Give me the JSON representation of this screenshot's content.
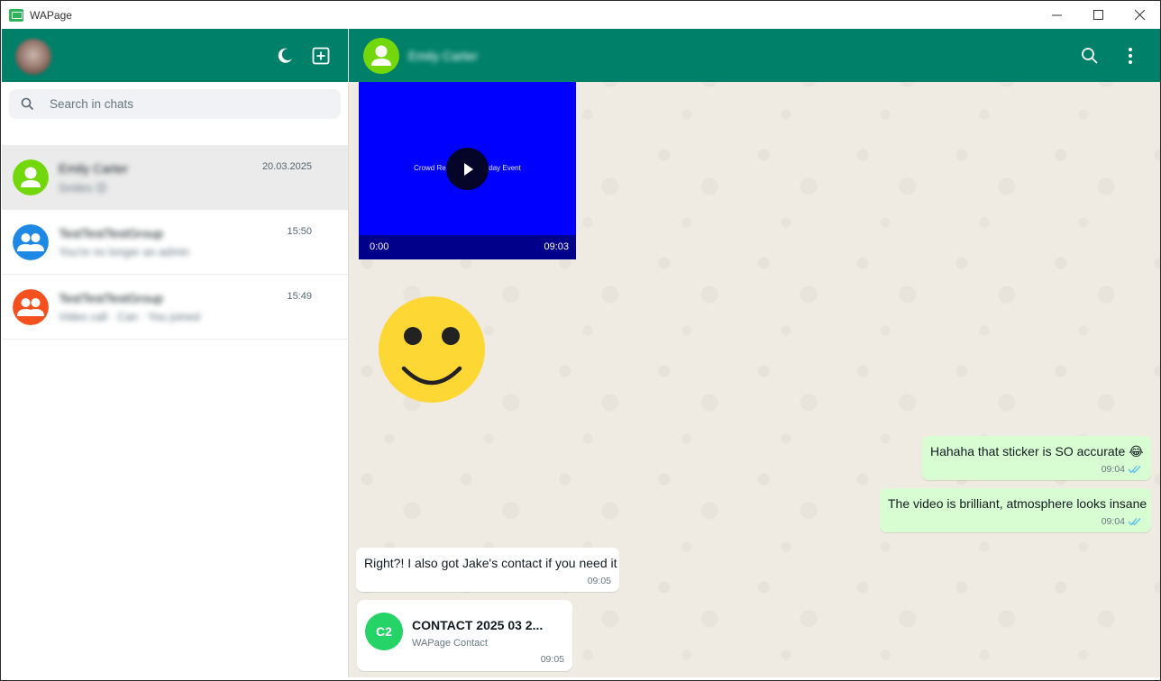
{
  "app": {
    "title": "WAPage"
  },
  "window_controls": {
    "minimize": "—",
    "maximize": "☐",
    "close": "✕"
  },
  "sidebar": {
    "search": {
      "placeholder": "Search in chats",
      "value": ""
    },
    "chats": [
      {
        "name": "Emily Carter",
        "preview": "Smiles 😊",
        "time": "20.03.2025",
        "avatar_color": "#72d70b",
        "avatar_kind": "person",
        "active": true
      },
      {
        "name": "TestTestTestGroup",
        "preview": "You're no longer an admin",
        "time": "15:50",
        "avatar_color": "#1e88e5",
        "avatar_kind": "group",
        "active": false
      },
      {
        "name": "TestTestTestGroup",
        "preview": "Video call · Can · You joined",
        "time": "15:49",
        "avatar_color": "#f4511e",
        "avatar_kind": "group",
        "active": false
      }
    ]
  },
  "conversation": {
    "contact_name": "Emily Carter",
    "contact_avatar_color": "#72d70b",
    "video": {
      "caption": "Crowd Reaction - Saturday Event",
      "current_time": "0:00",
      "duration": "09:03"
    },
    "sticker": {
      "name": "smiley-face-sticker"
    },
    "messages": [
      {
        "direction": "out",
        "text": "Hahaha that sticker is SO accurate 😂",
        "time": "09:04",
        "status": "read"
      },
      {
        "direction": "out",
        "text": "The video is brilliant, atmosphere looks insane",
        "time": "09:04",
        "status": "read"
      },
      {
        "direction": "in",
        "text": "Right?! I also got Jake's contact if you need it",
        "time": "09:05"
      }
    ],
    "contact_card": {
      "initials": "C2",
      "title": "CONTACT 2025 03 2...",
      "subtitle": "WAPage Contact",
      "time": "09:05"
    }
  },
  "colors": {
    "header": "#008069",
    "outgoing_bubble": "#d9fdd3",
    "read_ticks": "#53bdeb"
  }
}
